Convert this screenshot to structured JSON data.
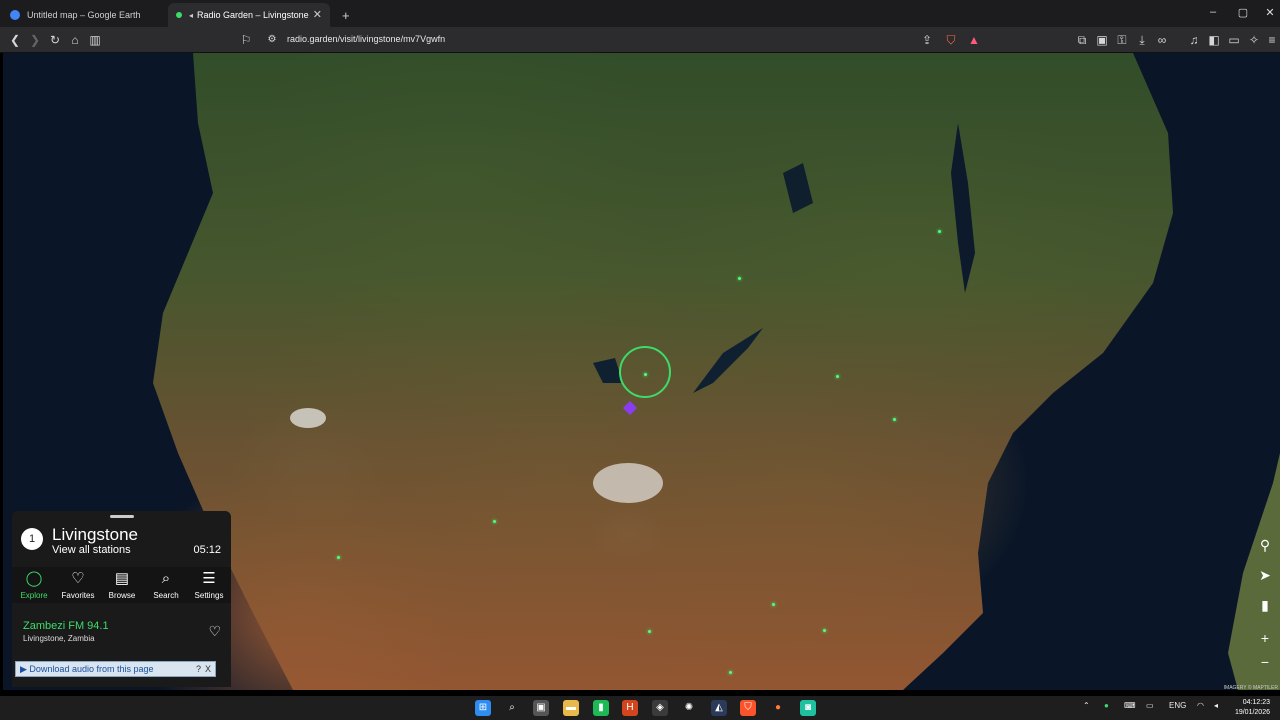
{
  "tabs": [
    {
      "title": "Untitled map – Google Earth",
      "active": false,
      "favicon_color": "#4285f4"
    },
    {
      "title": "Radio Garden – Livingstone",
      "active": true,
      "favicon_color": "#3ddc6a"
    }
  ],
  "new_tab_label": "+",
  "window_controls": {
    "minimize": "–",
    "maximize": "▢",
    "close": "✕"
  },
  "address_bar": {
    "url": "radio.garden/visit/livingstone/mv7Vgwfn"
  },
  "panel": {
    "badge": "1",
    "place": "Livingstone",
    "view_all": "View all stations",
    "local_time": "05:12",
    "nav": [
      {
        "label": "Explore",
        "icon": "explore-icon",
        "glyph": "◯",
        "active": true
      },
      {
        "label": "Favorites",
        "icon": "heart-icon",
        "glyph": "♡",
        "active": false
      },
      {
        "label": "Browse",
        "icon": "map-icon",
        "glyph": "▤",
        "active": false
      },
      {
        "label": "Search",
        "icon": "search-icon",
        "glyph": "⌕",
        "active": false
      },
      {
        "label": "Settings",
        "icon": "menu-icon",
        "glyph": "☰",
        "active": false
      }
    ],
    "station": {
      "name": "Zambezi FM 94.1",
      "location": "Livingstone, Zambia"
    },
    "download_bar": {
      "label": "Download audio from this page",
      "help": "?",
      "close": "X"
    }
  },
  "map_attribution": "IMAGERY © MAPTILER",
  "taskbar": {
    "tray": {
      "language": "ENG",
      "time": "04:12:23",
      "date": "19/01/2026"
    }
  },
  "colors": {
    "accent_green": "#3ddc6a",
    "panel_bg": "#1a1a1a",
    "browser_bg": "#2c2c2e"
  }
}
